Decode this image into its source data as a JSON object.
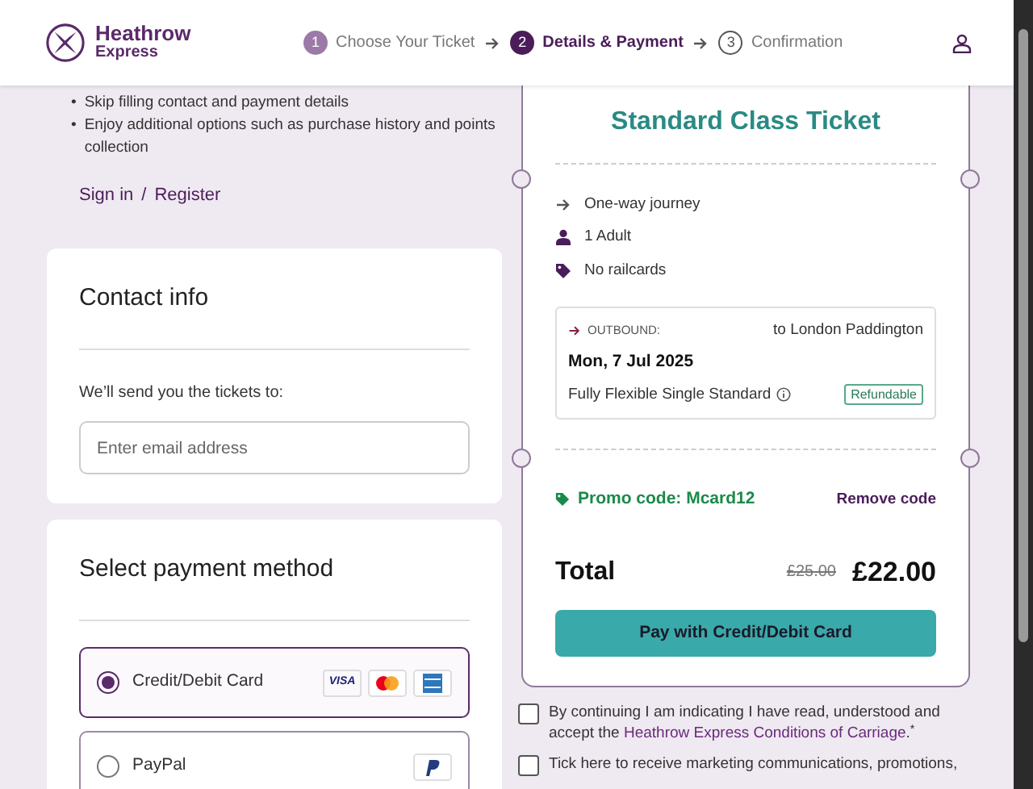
{
  "header": {
    "logo": {
      "line1": "Heathrow",
      "line2": "Express"
    },
    "steps": [
      {
        "number": "1",
        "label": "Choose Your Ticket",
        "completed": true,
        "selected": false
      },
      {
        "number": "2",
        "label": "Details & Payment",
        "completed": false,
        "selected": true
      },
      {
        "number": "3",
        "label": "Confirmation",
        "completed": false,
        "selected": false
      }
    ]
  },
  "benefits": [
    {
      "bullet": "•",
      "text": "Skip filling contact and payment details"
    },
    {
      "bullet": "•",
      "text": "Enjoy additional options such as purchase history and points collection"
    }
  ],
  "account_links": {
    "sign_in": "Sign in",
    "separator": "/",
    "register": "Register"
  },
  "contact": {
    "title": "Contact info",
    "prompt": "We’ll send you the tickets to:",
    "email": {
      "placeholder": "Enter email address"
    }
  },
  "payment": {
    "title": "Select payment method",
    "methods": [
      {
        "label": "Credit/Debit Card",
        "selected": true,
        "logos": [
          {
            "kind": "visa",
            "text": "VISA"
          },
          {
            "kind": "mastercard"
          },
          {
            "kind": "amex"
          }
        ]
      },
      {
        "label": "PayPal",
        "selected": false,
        "logos": [
          {
            "kind": "paypal"
          }
        ]
      }
    ]
  },
  "ticket": {
    "title": "Standard Class Ticket",
    "features": [
      {
        "kind": "arrow",
        "text": "One-way journey"
      },
      {
        "kind": "person",
        "text": "1 Adult"
      },
      {
        "kind": "tag",
        "text": "No railcards"
      }
    ],
    "journey": {
      "direction": "OUTBOUND:",
      "destination": "to London Paddington",
      "date": "Mon, 7 Jul 2025",
      "fare": "Fully Flexible Single Standard",
      "badge": "Refundable"
    },
    "promo": {
      "label": "Promo code: Mcard12",
      "remove": "Remove code"
    },
    "total": {
      "label": "Total",
      "old_price": "£25.00",
      "price": "£22.00"
    },
    "pay_button": "Pay with Credit/Debit Card"
  },
  "consents": [
    {
      "text": "By continuing I am indicating I have read, understood and accept the ",
      "link": "Heathrow Express Conditions of Carriage",
      "after": ".$^{*}$",
      "checked": false
    },
    {
      "text": "Tick here to receive marketing communications, promotions,",
      "checked": false
    }
  ]
}
